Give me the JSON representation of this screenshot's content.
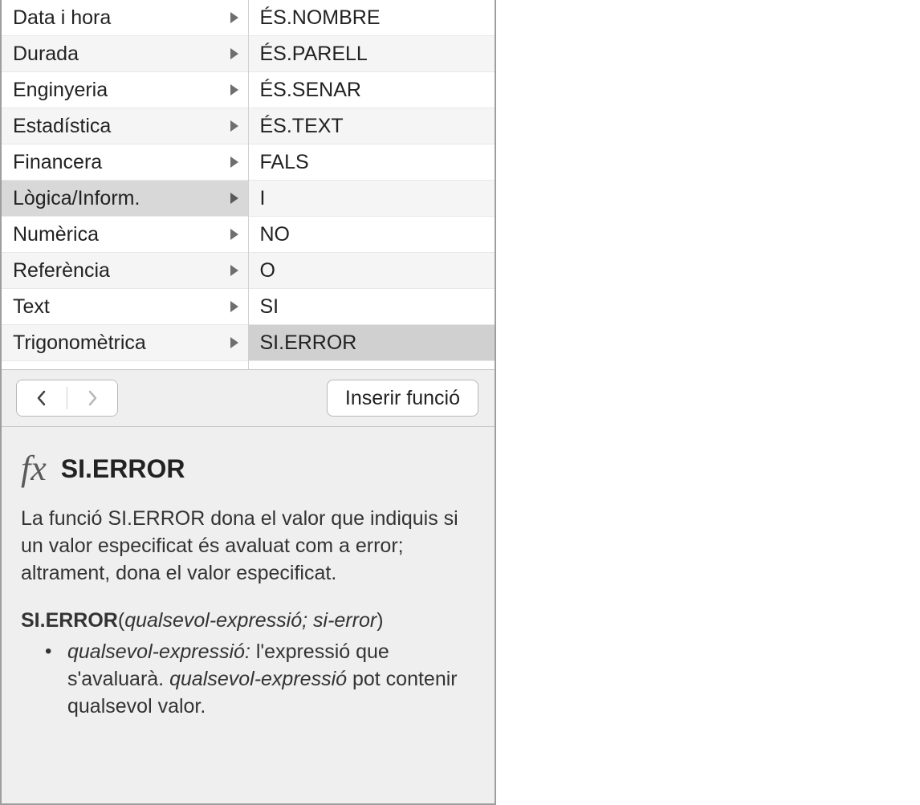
{
  "categories": [
    {
      "label": "Data i hora",
      "active": false
    },
    {
      "label": "Durada",
      "active": false
    },
    {
      "label": "Enginyeria",
      "active": false
    },
    {
      "label": "Estadística",
      "active": false
    },
    {
      "label": "Financera",
      "active": false
    },
    {
      "label": "Lògica/Inform.",
      "active": true
    },
    {
      "label": "Numèrica",
      "active": false
    },
    {
      "label": "Referència",
      "active": false
    },
    {
      "label": "Text",
      "active": false
    },
    {
      "label": "Trigonomètrica",
      "active": false
    }
  ],
  "functions": [
    {
      "label": "ÉS.NOMBRE",
      "selected": false
    },
    {
      "label": "ÉS.PARELL",
      "selected": false
    },
    {
      "label": "ÉS.SENAR",
      "selected": false
    },
    {
      "label": "ÉS.TEXT",
      "selected": false
    },
    {
      "label": "FALS",
      "selected": false
    },
    {
      "label": "I",
      "selected": false
    },
    {
      "label": "NO",
      "selected": false
    },
    {
      "label": "O",
      "selected": false
    },
    {
      "label": "SI",
      "selected": false
    },
    {
      "label": "SI.ERROR",
      "selected": true
    }
  ],
  "toolbar": {
    "insert_label": "Inserir funció"
  },
  "help": {
    "fx_glyph": "fx",
    "title": "SI.ERROR",
    "description": "La funció SI.ERROR dona el valor que indiquis si un valor especificat és avaluat com a error; altrament, dona el valor especificat.",
    "signature_fn": "SI.ERROR",
    "signature_open": "(",
    "signature_args": "qualsevol-expressió; si-error",
    "signature_close": ")",
    "param1_name": "qualsevol-expressió:",
    "param1_body1": " l'expressió que s'avaluarà. ",
    "param1_inner_italic": "qualsevol-expressió",
    "param1_body2": " pot contenir qualsevol valor."
  }
}
